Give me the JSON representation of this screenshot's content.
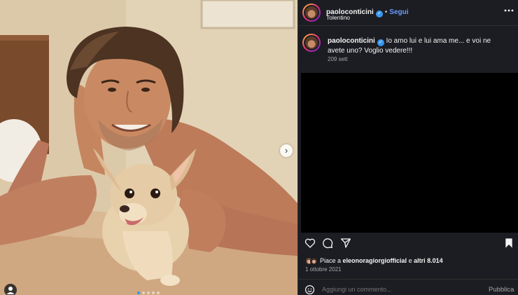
{
  "post": {
    "username": "paoloconticini",
    "verified_mark": "✓",
    "separator": "•",
    "follow_label": "Segui",
    "location": "Tolentino",
    "more_label": "•••",
    "caption_username": "paoloconticini",
    "caption_text": "Io amo lui e lui ama me... e voi ne avete uno? Voglio vedere!!!",
    "timestamp": "209 sett"
  },
  "carousel": {
    "next_label": "›",
    "slide_count": 5,
    "active_slide": 1
  },
  "engagement": {
    "likes_prefix": "Piace a",
    "likes_user": "eleonoragiorgiofficial",
    "likes_and": "e",
    "likes_others": "altri 8.014",
    "date": "1 ottobre 2021"
  },
  "comment": {
    "placeholder": "Aggiungi un commento...",
    "publish_label": "Pubblica"
  },
  "icons": {
    "like": "heart-icon",
    "comment": "comment-icon",
    "share": "share-icon",
    "save": "bookmark-icon",
    "emoji": "emoji-icon",
    "tag": "user-tag-icon",
    "next": "chevron-right-icon",
    "more": "more-options-icon"
  },
  "colors": {
    "panel_bg": "#1c1d22",
    "follow": "#6a9cff",
    "verified": "#3897f0"
  }
}
